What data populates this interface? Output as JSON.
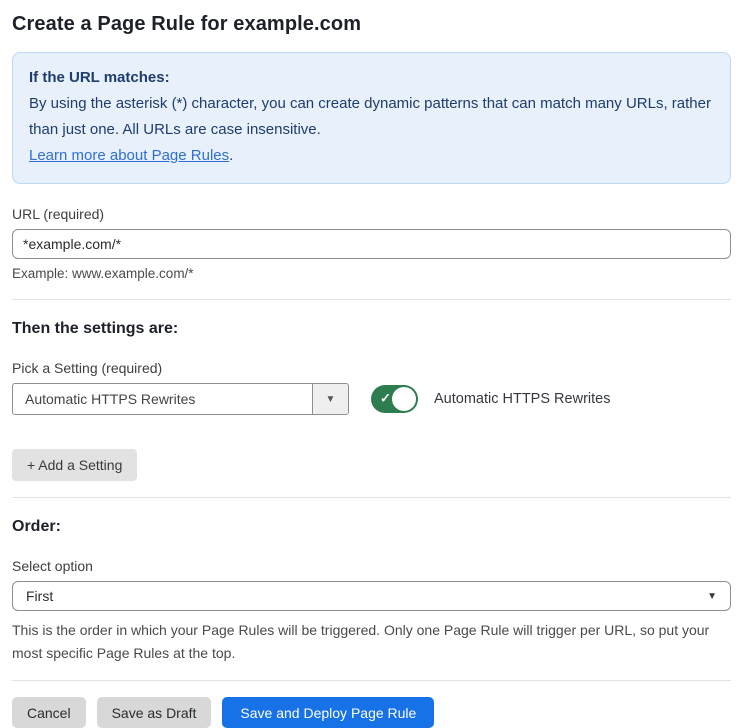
{
  "page": {
    "title": "Create a Page Rule for example.com"
  },
  "info_box": {
    "heading": "If the URL matches:",
    "body": "By using the asterisk (*) character, you can create dynamic patterns that can match many URLs, rather than just one. All URLs are case insensitive.",
    "link_label": "Learn more about Page Rules",
    "link_suffix": "."
  },
  "url_field": {
    "label": "URL (required)",
    "value": "*example.com/*",
    "helper": "Example: www.example.com/*"
  },
  "settings_section": {
    "heading": "Then the settings are:",
    "picker_label": "Pick a Setting (required)",
    "picker_value": "Automatic HTTPS Rewrites",
    "toggle_state": "on",
    "toggle_label": "Automatic HTTPS Rewrites",
    "add_button_label": "+ Add a Setting"
  },
  "order_section": {
    "heading": "Order:",
    "select_label": "Select option",
    "select_value": "First",
    "helper": "This is the order in which your Page Rules will be triggered. Only one Page Rule will trigger per URL, so put your most specific Page Rules at the top."
  },
  "footer": {
    "cancel_label": "Cancel",
    "save_draft_label": "Save as Draft",
    "save_deploy_label": "Save and Deploy Page Rule"
  },
  "icons": {
    "dropdown_arrow": "▼",
    "toggle_check": "✓"
  },
  "colors": {
    "accent_blue": "#1672e6",
    "info_bg": "#e8f1fb",
    "info_border": "#bed9f3",
    "info_text": "#1e3c6c",
    "link_blue": "#2f6fd3",
    "toggle_green": "#2d7d4e"
  }
}
